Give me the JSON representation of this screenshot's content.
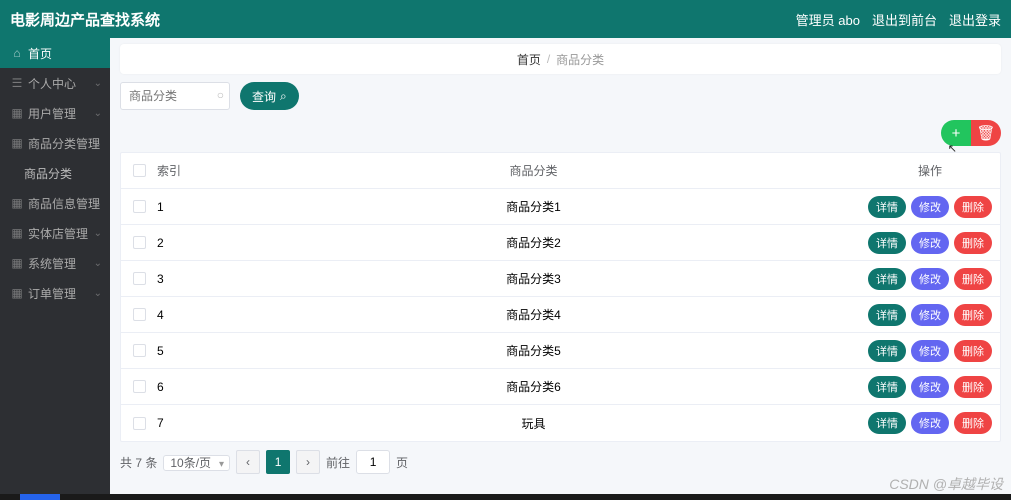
{
  "header": {
    "title": "电影周边产品查找系统",
    "admin_label": "管理员 abo",
    "logout_front": "退出到前台",
    "logout": "退出登录"
  },
  "sidebar": {
    "items": [
      {
        "label": "首页",
        "icon": "⌂",
        "active": true
      },
      {
        "label": "个人中心",
        "icon": "☰"
      },
      {
        "label": "用户管理",
        "icon": "▦"
      },
      {
        "label": "商品分类管理",
        "icon": "▦"
      },
      {
        "label": "商品分类",
        "icon": "",
        "sub": true
      },
      {
        "label": "商品信息管理",
        "icon": "▦"
      },
      {
        "label": "实体店管理",
        "icon": "▦"
      },
      {
        "label": "系统管理",
        "icon": "▦"
      },
      {
        "label": "订单管理",
        "icon": "▦"
      }
    ]
  },
  "breadcrumb": {
    "home": "首页",
    "current": "商品分类"
  },
  "search": {
    "placeholder": "商品分类",
    "button": "查询"
  },
  "table": {
    "headers": {
      "index": "索引",
      "category": "商品分类",
      "ops": "操作"
    },
    "rows": [
      {
        "index": "1",
        "category": "商品分类1"
      },
      {
        "index": "2",
        "category": "商品分类2"
      },
      {
        "index": "3",
        "category": "商品分类3"
      },
      {
        "index": "4",
        "category": "商品分类4"
      },
      {
        "index": "5",
        "category": "商品分类5"
      },
      {
        "index": "6",
        "category": "商品分类6"
      },
      {
        "index": "7",
        "category": "玩具"
      }
    ],
    "op_labels": {
      "detail": "详情",
      "edit": "修改",
      "delete": "删除"
    }
  },
  "pagination": {
    "total_text": "共 7 条",
    "page_size": "10条/页",
    "current": "1",
    "goto_label": "前往",
    "goto_value": "1",
    "page_unit": "页"
  },
  "watermark": "CSDN @卓越毕设"
}
